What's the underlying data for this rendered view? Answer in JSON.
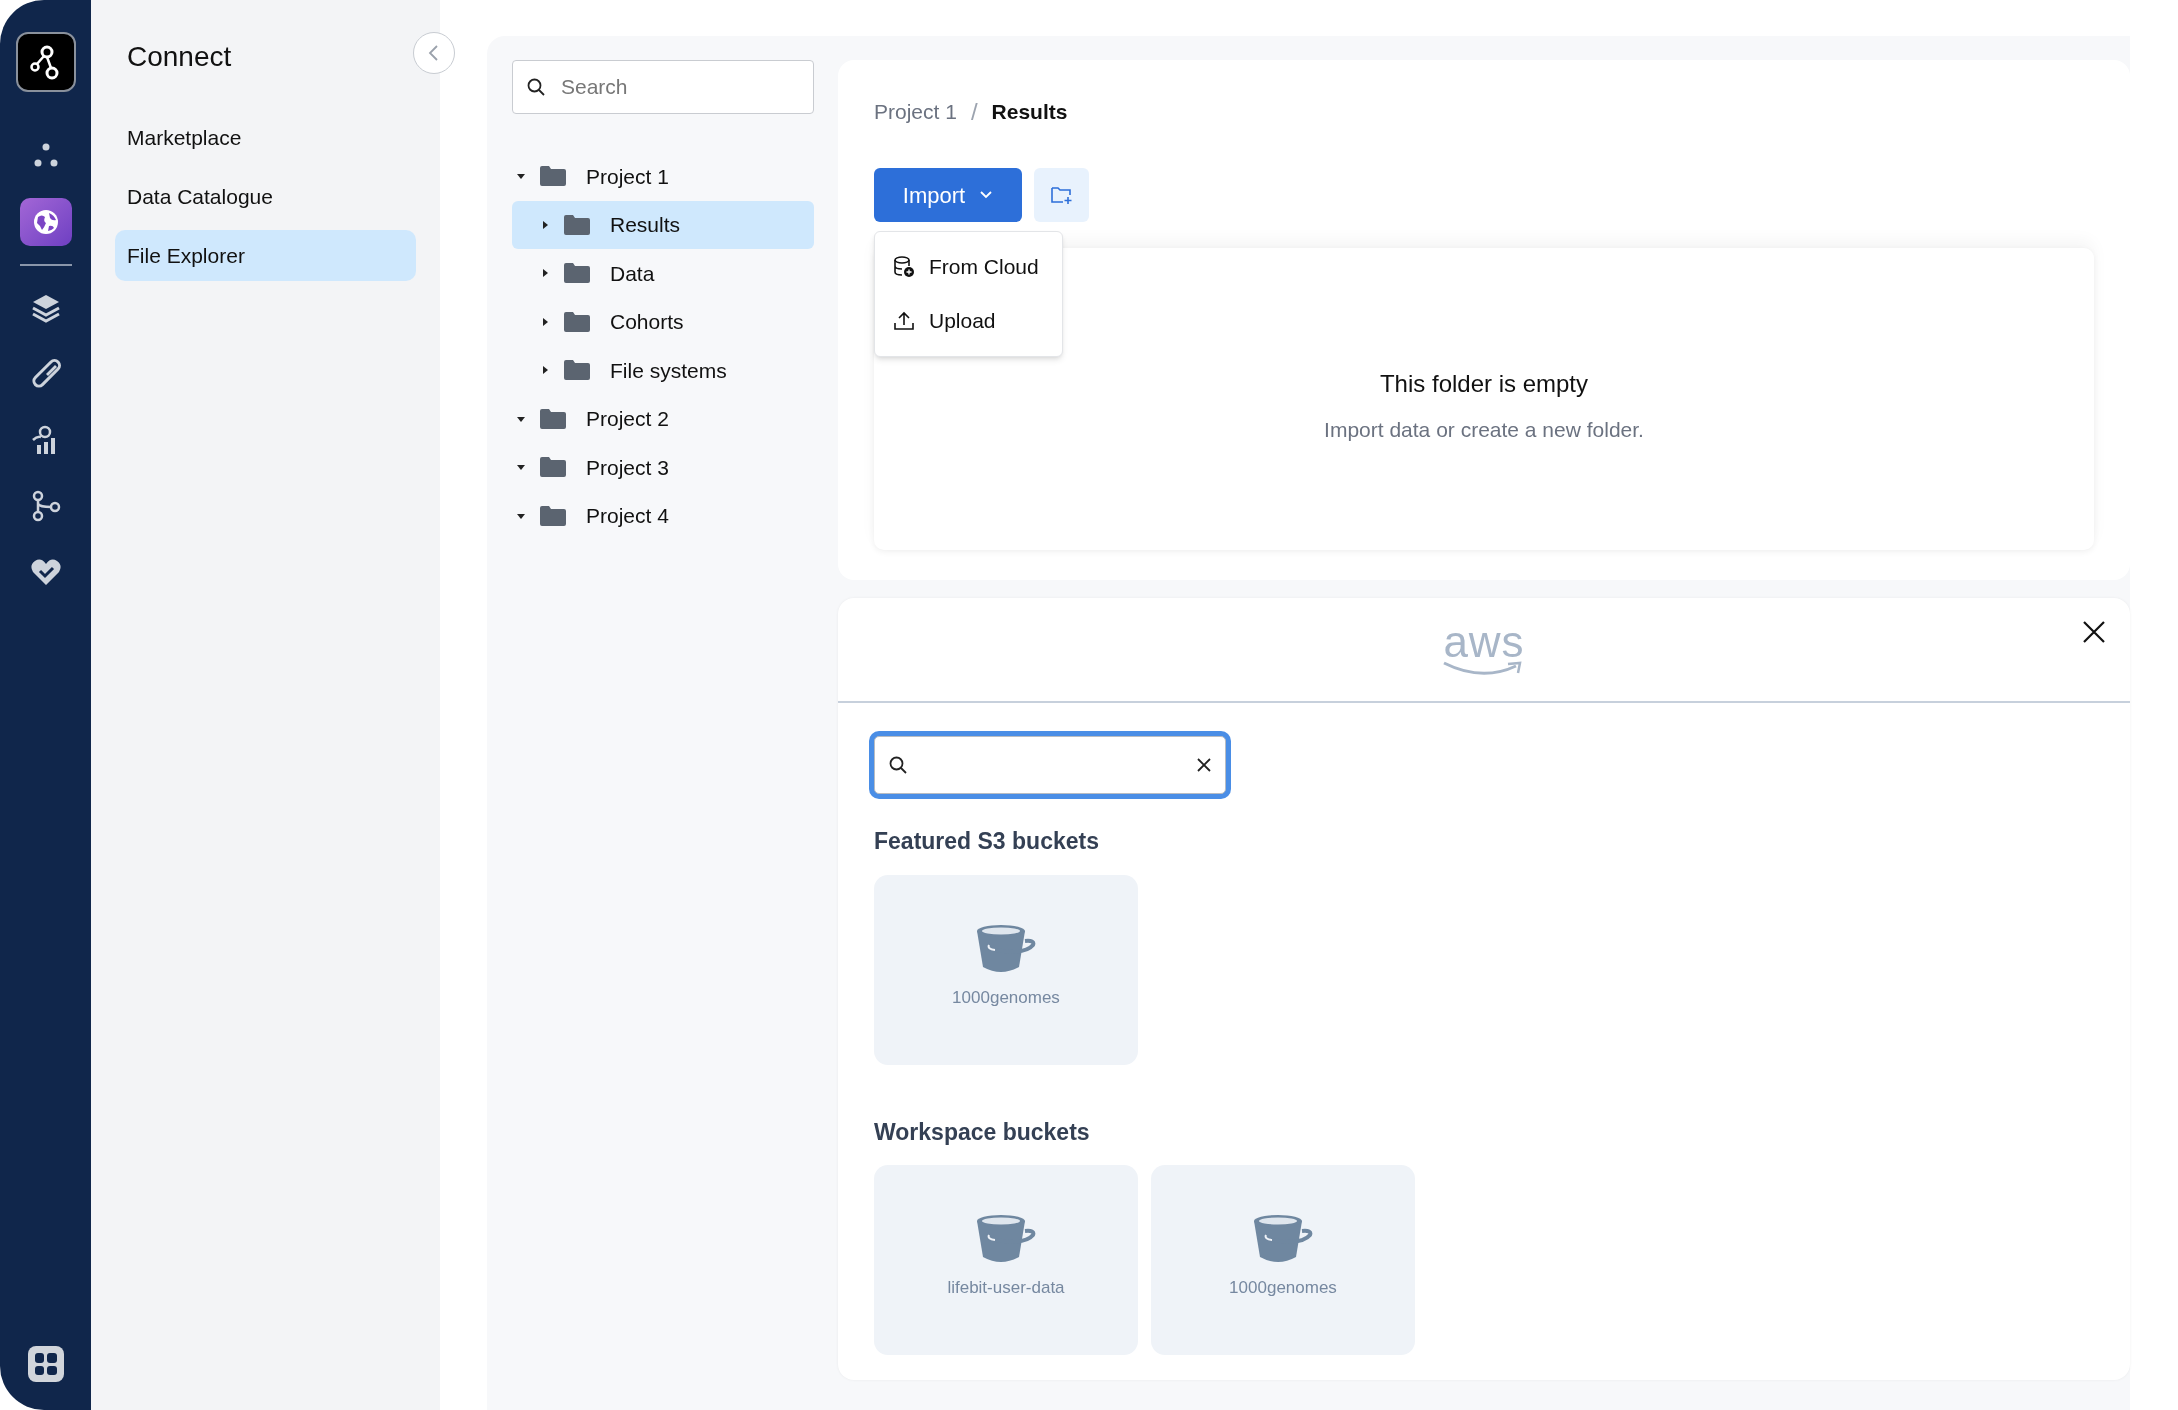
{
  "rail": [
    {
      "selected": false
    },
    {
      "selected": true
    },
    {
      "selected": false
    },
    {
      "selected": false
    },
    {
      "selected": false
    },
    {
      "selected": false
    },
    {
      "selected": false
    }
  ],
  "sidebar": {
    "title": "Connect",
    "items": [
      {
        "label": "Marketplace",
        "selected": false
      },
      {
        "label": "Data Catalogue",
        "selected": false
      },
      {
        "label": "File Explorer",
        "selected": true
      }
    ]
  },
  "tree": {
    "search": {
      "placeholder": "Search"
    },
    "nodes": [
      {
        "label": "Project 1",
        "expanded": true,
        "selected": false,
        "children": [
          {
            "label": "Results",
            "expanded": false,
            "selected": true
          },
          {
            "label": "Data",
            "expanded": false,
            "selected": false
          },
          {
            "label": "Cohorts",
            "expanded": false,
            "selected": false
          },
          {
            "label": "File systems",
            "expanded": false,
            "selected": false
          }
        ]
      },
      {
        "label": "Project 2",
        "expanded": true,
        "selected": false
      },
      {
        "label": "Project 3",
        "expanded": true,
        "selected": false
      },
      {
        "label": "Project 4",
        "expanded": true,
        "selected": false
      }
    ]
  },
  "breadcrumb": [
    "Project 1",
    "/",
    "Results"
  ],
  "import_button": {
    "label": "Import",
    "menu": [
      {
        "label": "From Cloud",
        "kind": "cloud"
      },
      {
        "label": "Upload",
        "kind": "upload"
      }
    ]
  },
  "empty_state": {
    "title": "This folder is empty",
    "message": "Import data or create a new folder."
  },
  "aws_panel": {
    "logo": "aws",
    "search": {
      "focused": true
    },
    "sections": [
      {
        "title": "Featured S3 buckets",
        "buckets": [
          "1000genomes"
        ]
      },
      {
        "title": "Workspace buckets",
        "buckets": [
          "lifebit-user-data",
          "1000genomes"
        ]
      }
    ]
  }
}
